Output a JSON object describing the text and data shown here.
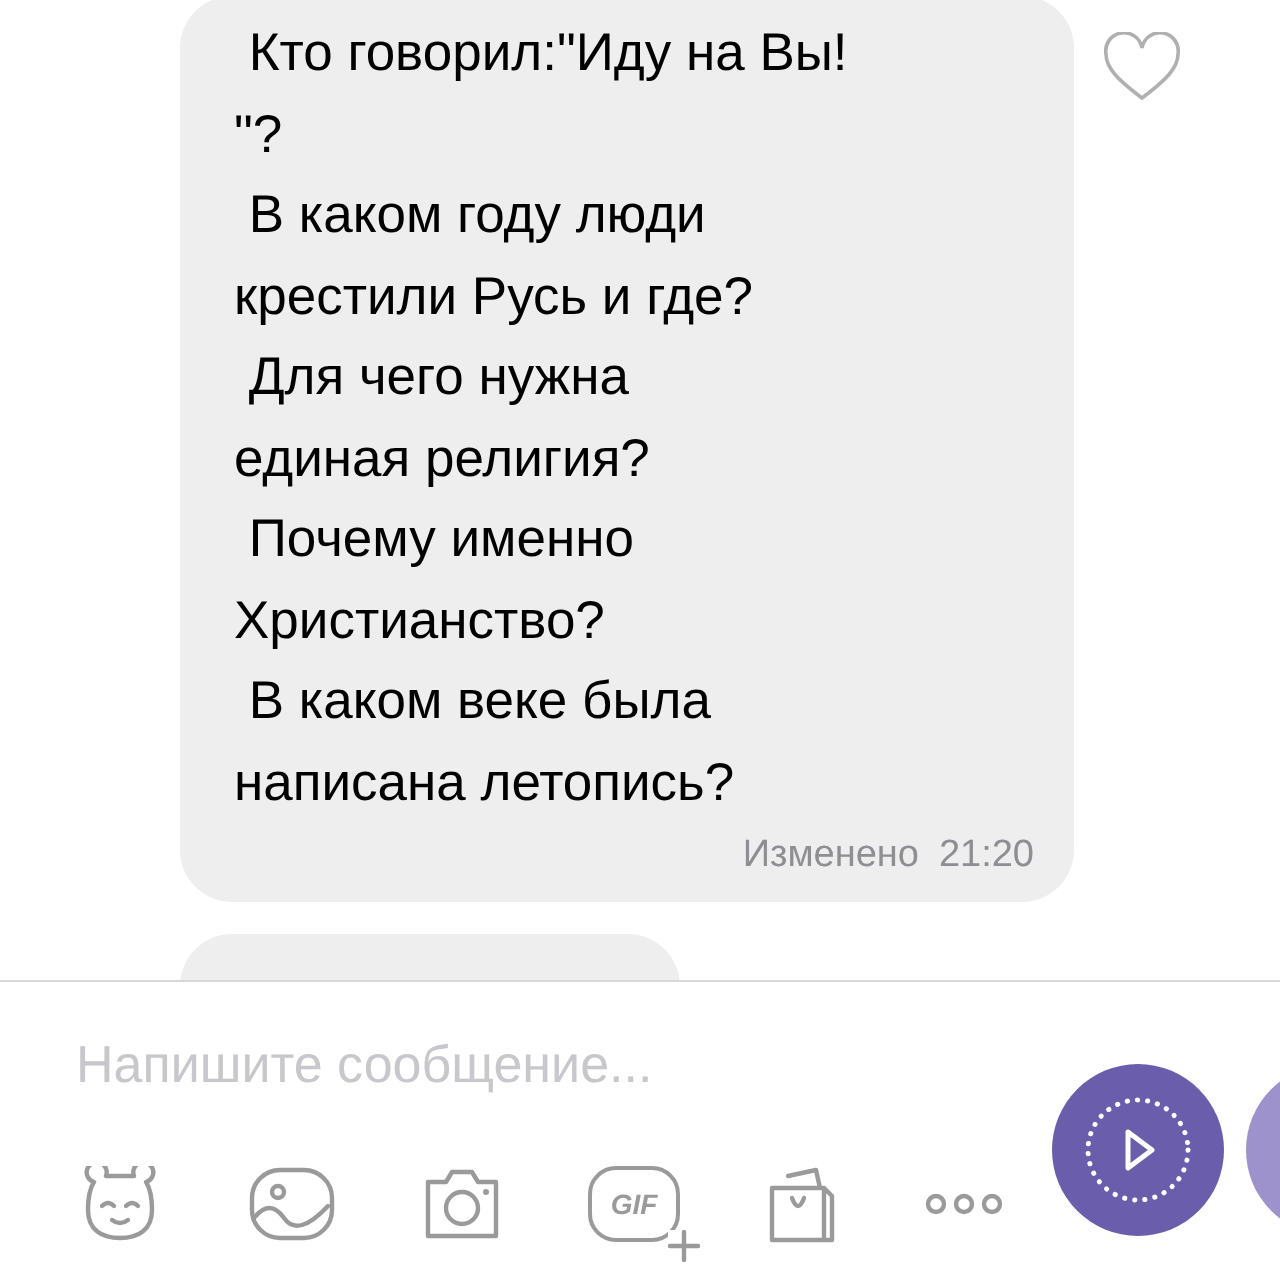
{
  "messages": [
    {
      "kind": "text",
      "lines": [
        " Кто говорил:\"Иду на Вы!",
        "\"?",
        " В каком году люди",
        "крестили Русь и где?",
        " Для чего нужна",
        "единая религия?",
        " Почему именно",
        "Христианство?",
        " В каком веке была",
        "написана летопись?"
      ],
      "status": "Изменено",
      "time": "21:20",
      "liked": false
    },
    {
      "kind": "cut"
    }
  ],
  "composer": {
    "placeholder": "Напишите сообщение..."
  },
  "toolbar": [
    {
      "kind": "sticker"
    },
    {
      "kind": "gallery"
    },
    {
      "kind": "camera"
    },
    {
      "kind": "gif",
      "label": "GIF"
    },
    {
      "kind": "shop"
    },
    {
      "kind": "more"
    }
  ]
}
